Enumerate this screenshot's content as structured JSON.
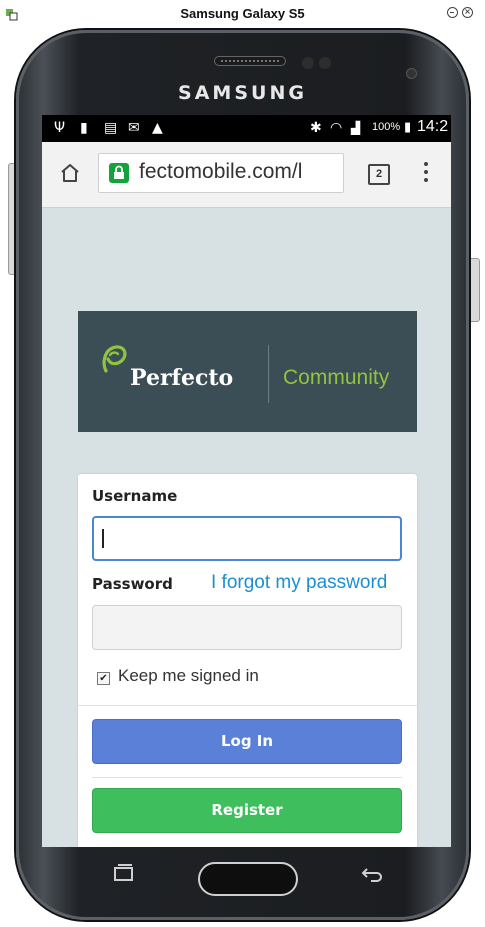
{
  "window": {
    "title": "Samsung Galaxy S5"
  },
  "device": {
    "brand": "SAMSUNG"
  },
  "status_bar": {
    "battery": "100%",
    "time": "14:2"
  },
  "browser": {
    "url": "fectomobile.com/l",
    "tab_count": "2"
  },
  "banner": {
    "name": "Perfecto",
    "tagline": "Community"
  },
  "login": {
    "username_label": "Username",
    "username_value": "",
    "password_label": "Password",
    "password_value": "",
    "forgot_link": "I forgot my password",
    "keep_signed_in_label": "Keep me signed in",
    "keep_signed_in_checked": true,
    "login_button": "Log In",
    "register_button": "Register"
  },
  "colors": {
    "login_button": "#5b80d8",
    "register_button": "#3fbe5e",
    "link": "#1b8fd0",
    "banner_bg": "#3b4d55",
    "banner_accent": "#8fc341",
    "lock_green": "#14a33a",
    "screen_bg": "#d7e0e3"
  }
}
